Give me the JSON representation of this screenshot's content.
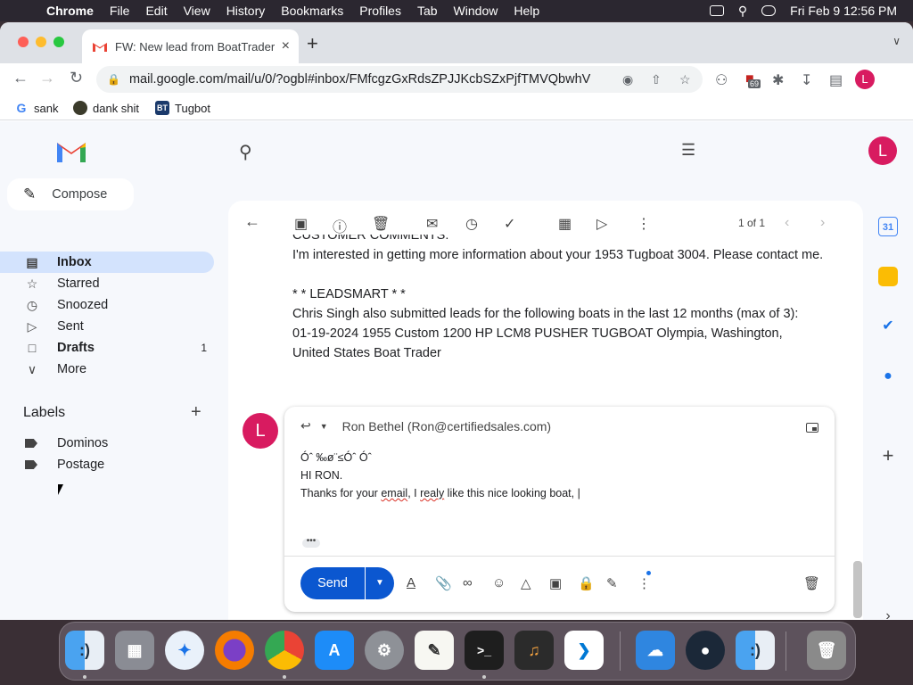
{
  "menubar": {
    "app": "Chrome",
    "items": [
      "File",
      "Edit",
      "View",
      "History",
      "Bookmarks",
      "Profiles",
      "Tab",
      "Window",
      "Help"
    ],
    "datetime": "Fri Feb 9  12:56 PM"
  },
  "browser": {
    "tab_title": "FW: New lead from BoatTrader",
    "url": "mail.google.com/mail/u/0/?ogbl#inbox/FMfcgzGxRdsZPJJKcbSZxPjfTMVQbwhV",
    "extension_badge": "69",
    "profile_initial": "L",
    "bookmarks": [
      {
        "label": "sank",
        "icon": "google-icon",
        "color": "#4285f4"
      },
      {
        "label": "dank shit",
        "icon": "meme-icon",
        "color": "#3b3b2b"
      },
      {
        "label": "Tugbot",
        "icon": "boattrader-icon",
        "color": "#1b3a6b"
      }
    ]
  },
  "gmail": {
    "avatar_initial": "L",
    "compose_label": "Compose",
    "nav": [
      {
        "label": "Inbox",
        "icon": "inbox-icon",
        "active": true,
        "count": ""
      },
      {
        "label": "Starred",
        "icon": "star-icon",
        "active": false,
        "count": ""
      },
      {
        "label": "Snoozed",
        "icon": "clock-icon",
        "active": false,
        "count": ""
      },
      {
        "label": "Sent",
        "icon": "send-icon",
        "active": false,
        "count": ""
      },
      {
        "label": "Drafts",
        "icon": "draft-icon",
        "active": false,
        "count": "1"
      },
      {
        "label": "More",
        "icon": "chevron-down-icon",
        "active": false,
        "count": ""
      }
    ],
    "labels_heading": "Labels",
    "labels": [
      "Dominos",
      "Postage"
    ],
    "pagination": "1 of 1",
    "message_lines": [
      "CUSTOMER COMMENTS:",
      "I'm interested in getting more information about your 1953 Tugboat 3004. Please contact me.",
      "",
      "* * LEADSMART * *",
      "Chris Singh also submitted leads for the following boats in the last 12 months (max of 3):",
      "01-19-2024    1955 Custom 1200 HP LCM8 PUSHER TUGBOAT    Olympia, Washington,",
      "United States    Boat Trader"
    ],
    "reply": {
      "avatar_initial": "L",
      "recipient": "Ron Bethel (Ron@certifiedsales.com)",
      "line1": "Óˆ ‰ø¨≤Óˆ Óˆ",
      "line2": "HI RON.",
      "line3_a": "Thanks for your ",
      "line3_b": "email",
      "line3_c": ", I ",
      "line3_d": "realy",
      "line3_e": " like this nice looking boat, |",
      "send_label": "Send",
      "ellipsis": "•••"
    }
  },
  "colors": {
    "accent_blue": "#0b57d0",
    "avatar_pink": "#d81b60",
    "active_nav": "#d3e3fd"
  }
}
